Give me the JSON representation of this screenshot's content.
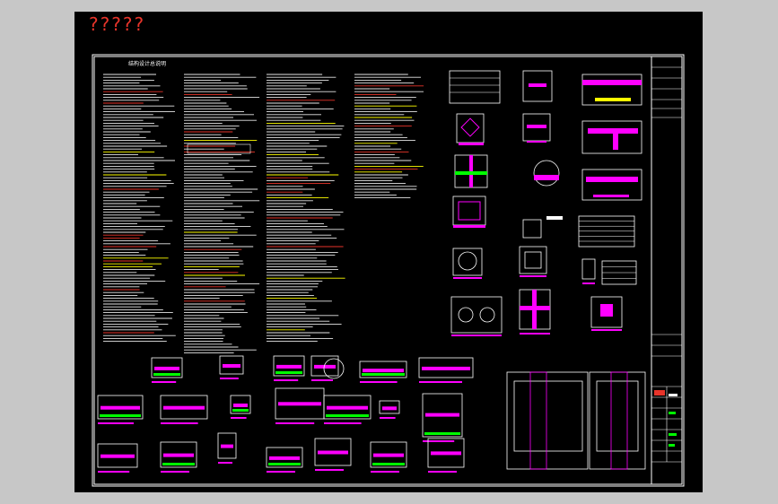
{
  "sheet_title": "?????",
  "notes_heading": "结构设计总说明",
  "colors": {
    "background": "#000000",
    "frame": "#ffffff",
    "rebar": "#ff00ff",
    "concrete_hatch": "#00ff00",
    "dimension": "#ffff00",
    "annotation": "#ffffff",
    "title_red": "#e8342a"
  }
}
